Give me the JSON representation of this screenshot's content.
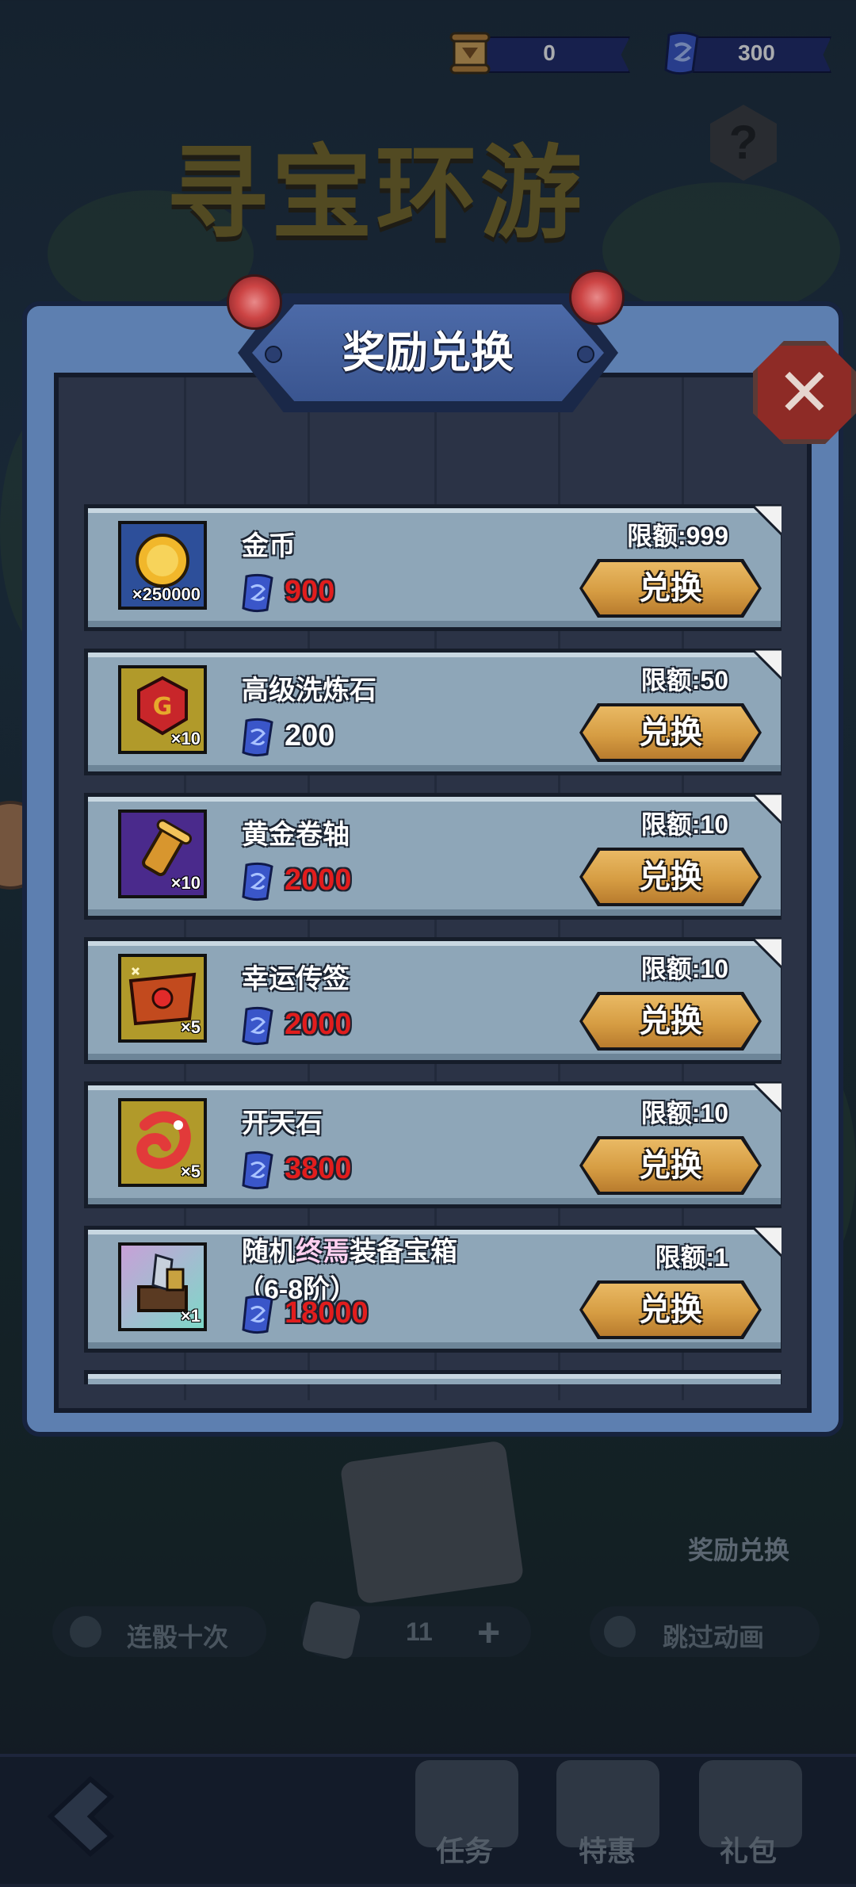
{
  "currency": [
    {
      "icon": "gold-scroll-icon",
      "value": "0"
    },
    {
      "icon": "blue-scroll-icon",
      "value": "300"
    }
  ],
  "background": {
    "title": "寻宝环游",
    "help": "?",
    "reward_label": "奖励兑换",
    "ten_roll_label": "连骰十次",
    "dice_count": "11",
    "plus": "+",
    "skip_anim_label": "跳过动画"
  },
  "panel": {
    "title": "奖励兑换",
    "close": "✕",
    "button_label": "兑换",
    "items": [
      {
        "name": "金币",
        "count": "×250000",
        "price": "900",
        "price_color": "#e11d1d",
        "limit": "限额:999",
        "icon_bg": "#2d4f9a",
        "icon": "gold-coin-icon"
      },
      {
        "name": "高级洗炼石",
        "count": "×10",
        "price": "200",
        "price_color": "#ffffff",
        "limit": "限额:50",
        "icon_bg": "#b19a2a",
        "icon": "red-gem-icon"
      },
      {
        "name": "黄金卷轴",
        "count": "×10",
        "price": "2000",
        "price_color": "#e11d1d",
        "limit": "限额:10",
        "icon_bg": "#4a2a8c",
        "icon": "golden-scroll-icon"
      },
      {
        "name": "幸运传签",
        "count": "×5",
        "price": "2000",
        "price_color": "#e11d1d",
        "limit": "限额:10",
        "icon_bg": "#b19a2a",
        "icon": "lucky-letter-icon"
      },
      {
        "name": "开天石",
        "count": "×5",
        "price": "3800",
        "price_color": "#e11d1d",
        "limit": "限额:10",
        "icon_bg": "#b19a2a",
        "icon": "red-dragon-stone-icon"
      },
      {
        "name_a": "随机",
        "name_hl": "终焉",
        "name_b": "装备宝箱",
        "name_sub": "（6-8阶）",
        "count": "×1",
        "price": "18000",
        "price_color": "#e11d1d",
        "limit": "限额:1",
        "icon_bg": "#b59bd0",
        "icon": "equipment-chest-icon"
      }
    ]
  },
  "bottom_nav": [
    {
      "label": "任务",
      "icon": "task-icon"
    },
    {
      "label": "特惠",
      "icon": "deal-icon"
    },
    {
      "label": "礼包",
      "icon": "gift-icon"
    }
  ]
}
